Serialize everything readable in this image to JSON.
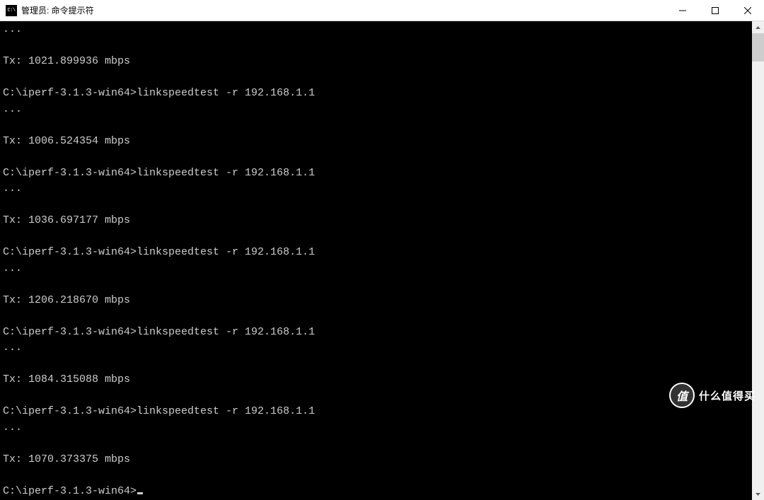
{
  "titlebar": {
    "icon_text": "C:\\",
    "title": "管理员: 命令提示符"
  },
  "terminal": {
    "prompt_path": "C:\\iperf-3.1.3-win64>",
    "command": "linkspeedtest -r 192.168.1.1",
    "ellipsis": "...",
    "results": [
      {
        "line": "Tx: 1021.899936 mbps"
      },
      {
        "line": "Tx: 1006.524354 mbps"
      },
      {
        "line": "Tx: 1036.697177 mbps"
      },
      {
        "line": "Tx: 1206.218670 mbps"
      },
      {
        "line": "Tx: 1084.315088 mbps"
      },
      {
        "line": "Tx: 1070.373375 mbps"
      }
    ]
  },
  "watermark": {
    "badge": "值",
    "text": "什么值得买"
  }
}
